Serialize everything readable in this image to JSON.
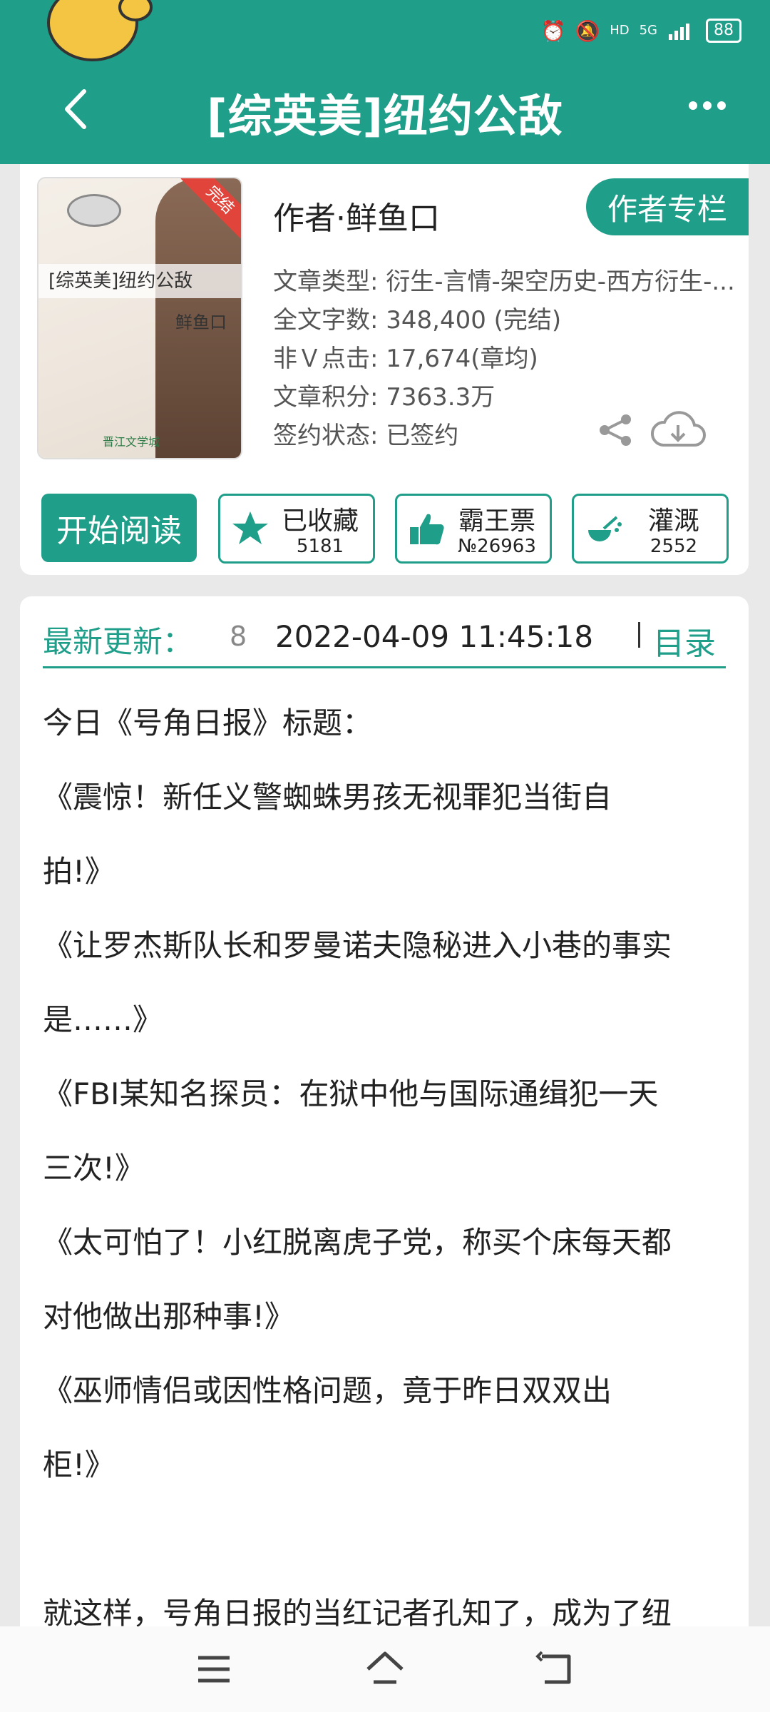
{
  "status": {
    "battery": "88",
    "icons": [
      "alarm-icon",
      "mute-icon",
      "hd-icon",
      "5g-icon",
      "signal-icon"
    ]
  },
  "header": {
    "title": "[综英美]纽约公敌"
  },
  "book": {
    "cover_title": "[综英美]纽约公敌",
    "cover_author": "鲜鱼口",
    "cover_ribbon": "完结",
    "cover_logo": "晋江文学城",
    "author": "作者·鲜鱼口",
    "author_column": "作者专栏",
    "meta": [
      "文章类型: 衍生-言情-架空历史-西方衍生-...",
      "全文字数: 348,400 (完结)",
      "非Ｖ点击: 17,674(章均)",
      "文章积分: 7363.3万",
      "签约状态: 已签约"
    ]
  },
  "actions": {
    "read": "开始阅读",
    "collect": {
      "label": "已收藏",
      "count": "5181"
    },
    "ticket": {
      "label": "霸王票",
      "count": "№26963"
    },
    "water": {
      "label": "灌溉",
      "count": "2552"
    }
  },
  "update": {
    "label": "最新更新：",
    "fragment": "8",
    "time": "2022-04-09 11:45:18",
    "toc": "目录"
  },
  "content": {
    "lines": [
      "今日《号角日报》标题：",
      "《震惊！新任义警蜘蛛男孩无视罪犯当街自",
      "拍!》",
      "《让罗杰斯队长和罗曼诺夫隐秘进入小巷的事实",
      "是……》",
      "《FBI某知名探员：在狱中他与国际通缉犯一天",
      "三次!》",
      "《太可怕了！小红脱离虎子党，称买个床每天都",
      "对他做出那种事!》",
      "《巫师情侣或因性格问题，竟于昨日双双出",
      "柜!》",
      "",
      "就这样，号角日报的当红记者孔知了，成为了纽"
    ]
  },
  "colors": {
    "accent": "#1f9e8a",
    "ribbon": "#e0443a"
  }
}
